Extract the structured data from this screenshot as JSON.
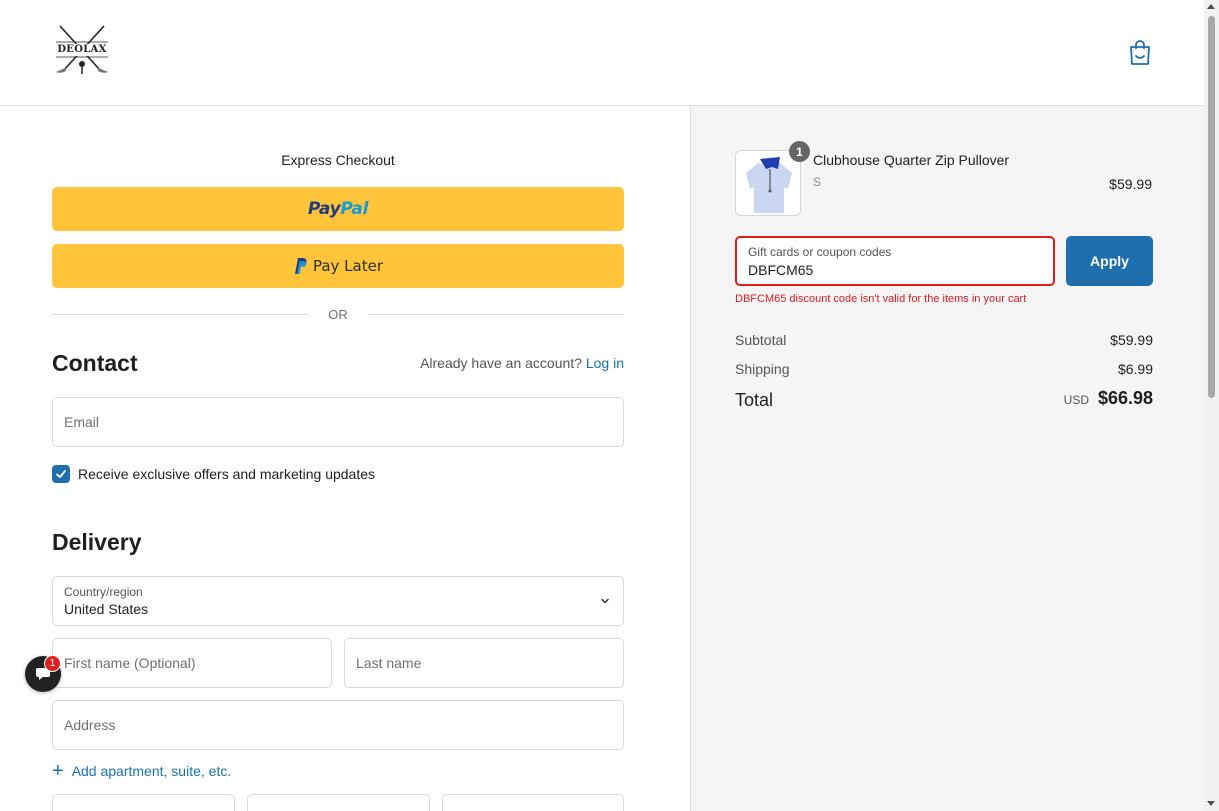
{
  "header": {
    "logo_text": "DEOLAX",
    "cart_icon": "shopping-bag-icon"
  },
  "express": {
    "title": "Express Checkout",
    "paypal_pay": "Pay",
    "paypal_pal": "Pal",
    "pay_later_label": "Pay Later",
    "or_text": "OR"
  },
  "contact": {
    "title": "Contact",
    "account_prompt": "Already have an account?",
    "login_label": "Log in",
    "email_placeholder": "Email",
    "marketing_label": "Receive exclusive offers and marketing updates",
    "marketing_checked": true
  },
  "delivery": {
    "title": "Delivery",
    "country_label": "Country/region",
    "country_value": "United States",
    "first_name_placeholder": "First name (Optional)",
    "last_name_placeholder": "Last name",
    "address_placeholder": "Address",
    "add_apartment_label": "Add apartment, suite, etc."
  },
  "chat": {
    "badge_count": "1",
    "icon": "chat-icon"
  },
  "order": {
    "item": {
      "quantity": "1",
      "name": "Clubhouse Quarter Zip Pullover",
      "variant": "S",
      "price": "$59.99"
    },
    "coupon": {
      "label": "Gift cards or coupon codes",
      "value": "DBFCM65",
      "apply_label": "Apply",
      "error": "DBFCM65 discount code isn't valid for the items in your cart"
    },
    "subtotal_label": "Subtotal",
    "subtotal_value": "$59.99",
    "shipping_label": "Shipping",
    "shipping_value": "$6.99",
    "total_label": "Total",
    "total_currency": "USD",
    "total_value": "$66.98"
  },
  "colors": {
    "accent": "#1f6ead",
    "link": "#1773b0",
    "paypal_yellow": "#ffc439",
    "error": "#dd1d1d"
  }
}
